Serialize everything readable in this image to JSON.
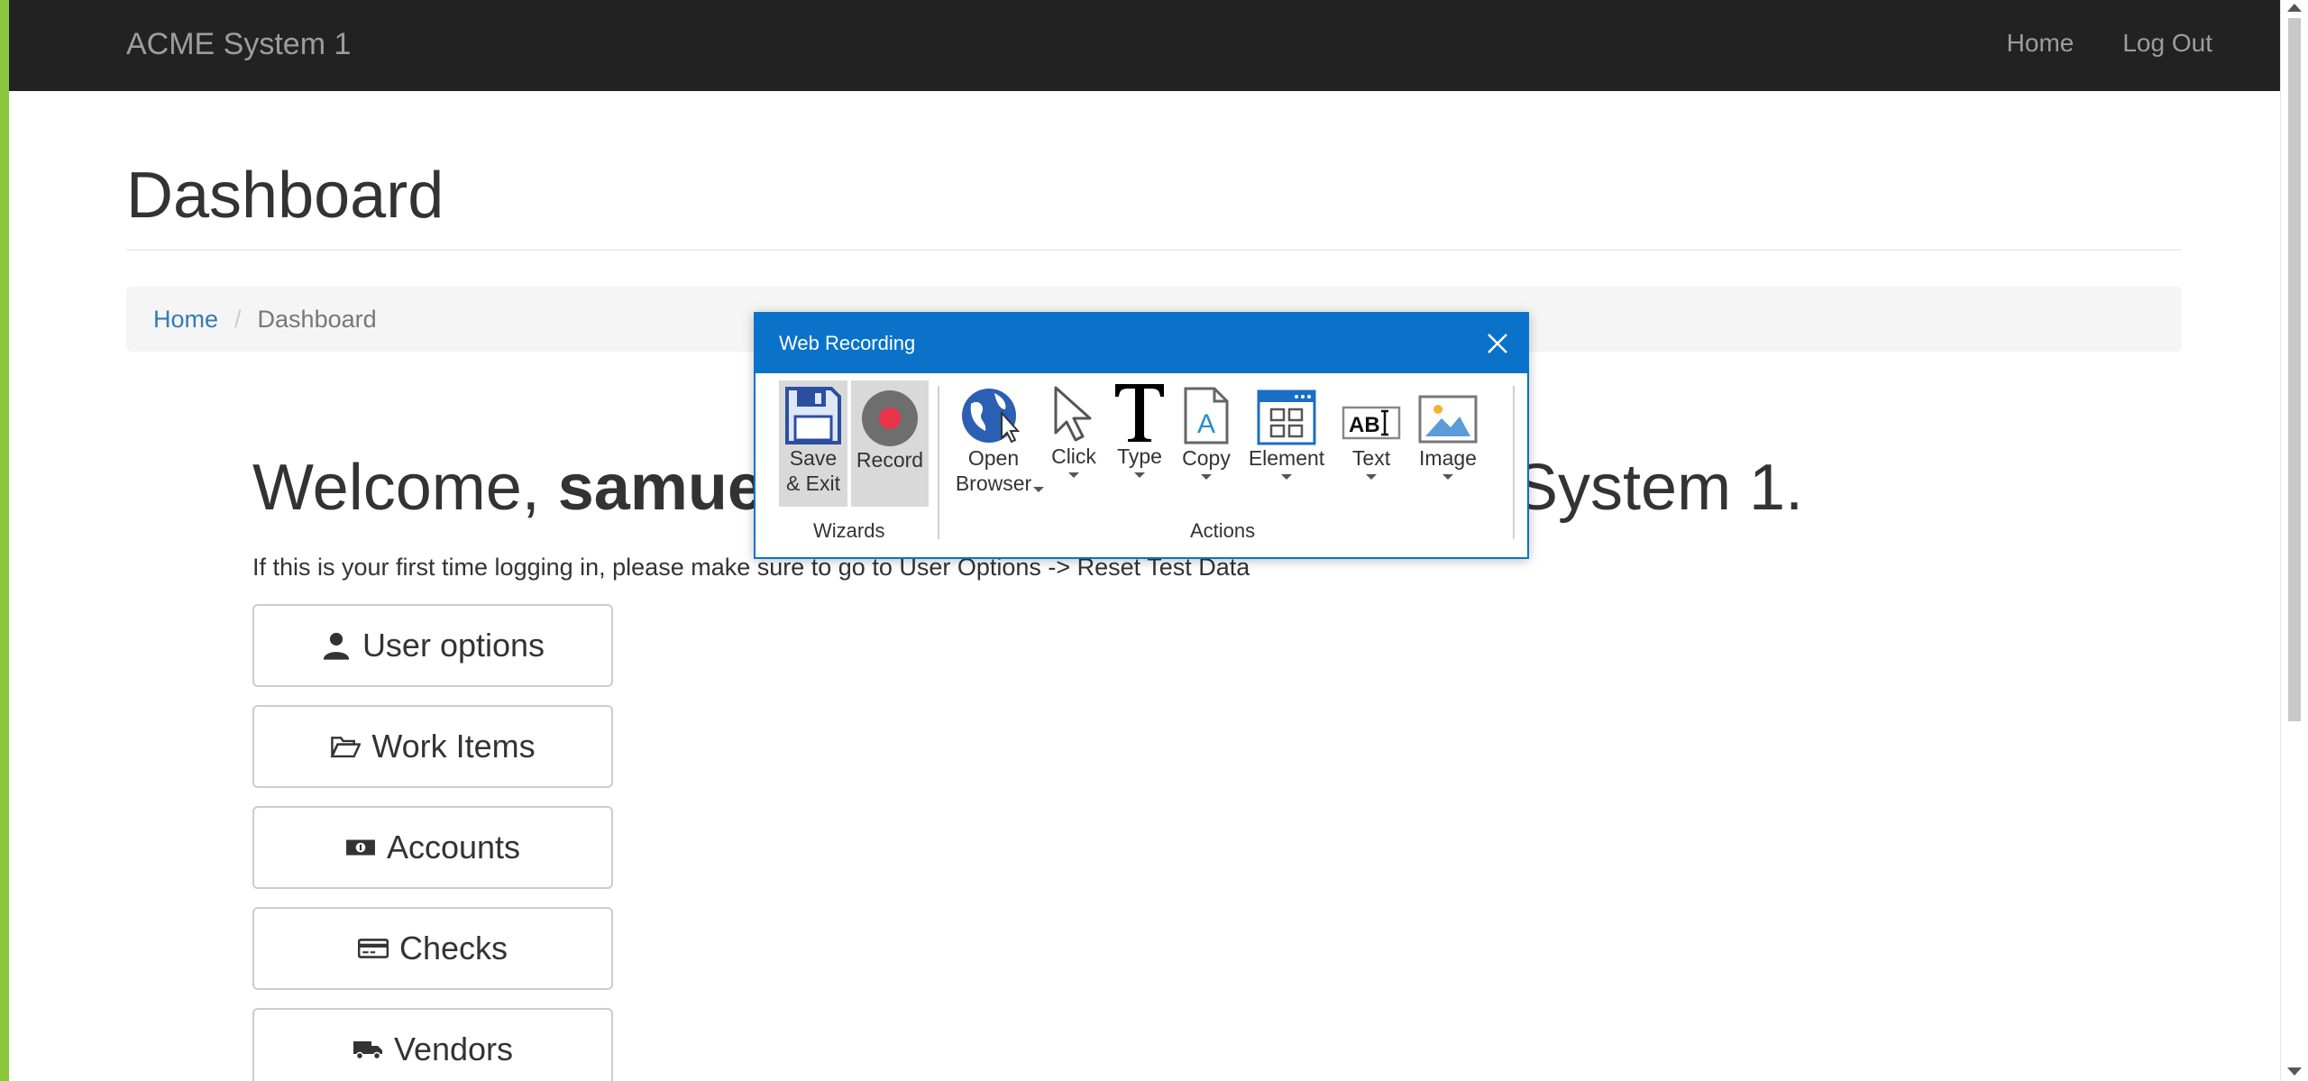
{
  "navbar": {
    "brand": "ACME System 1",
    "links": [
      "Home",
      "Log Out"
    ]
  },
  "page": {
    "title": "Dashboard"
  },
  "breadcrumb": {
    "home": "Home",
    "separator": "/",
    "current": "Dashboard"
  },
  "welcome": {
    "prefix": "Welcome, ",
    "user": "samue",
    "suffix": "System 1."
  },
  "notice": "If this is your first time logging in, please make sure to go to User Options -> Reset Test Data",
  "menu": [
    {
      "label": "User options",
      "icon": "user-icon"
    },
    {
      "label": "Work Items",
      "icon": "folder-open-icon"
    },
    {
      "label": "Accounts",
      "icon": "money-icon"
    },
    {
      "label": "Checks",
      "icon": "credit-card-icon"
    },
    {
      "label": "Vendors",
      "icon": "truck-icon"
    }
  ],
  "dialog": {
    "title": "Web Recording",
    "wizards": {
      "label": "Wizards",
      "save_line1": "Save",
      "save_line2": "& Exit",
      "record": "Record"
    },
    "actions": {
      "label": "Actions",
      "open_line1": "Open",
      "open_line2": "Browser",
      "click": "Click",
      "type": "Type",
      "copy": "Copy",
      "element": "Element",
      "text": "Text",
      "image": "Image"
    }
  },
  "colors": {
    "navbar": "#222222",
    "accent_green": "#8cc63f",
    "dialog_blue": "#0a73c9",
    "link": "#337ab7",
    "record_red": "#e8334a"
  }
}
